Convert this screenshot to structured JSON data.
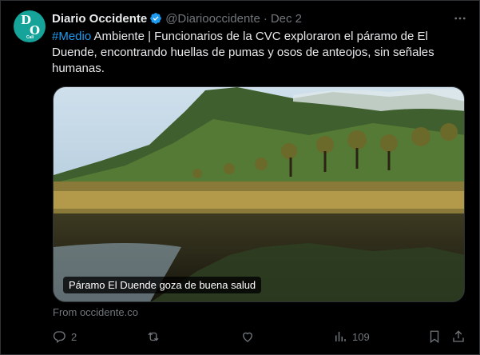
{
  "tweet": {
    "author_name": "Diario Occidente",
    "handle": "@Diariooccidente",
    "separator": "·",
    "date": "Dec 2",
    "avatar_letters": {
      "top": "D",
      "bottom": "O",
      "small": "Cali"
    },
    "hashtag": "#Medio",
    "text": " Ambiente | Funcionarios de la CVC exploraron el páramo de El Duende, encontrando huellas de pumas y osos de anteojos, sin señales humanas."
  },
  "card": {
    "caption": "Páramo El Duende goza de buena salud",
    "source": "From occidente.co"
  },
  "actions": {
    "replies": "2",
    "views": "109"
  },
  "colors": {
    "accent": "#1d9bf0",
    "muted": "#71767b",
    "avatar_bg": "#16a39a"
  },
  "icons": [
    "verified-badge-icon",
    "more-icon",
    "reply-icon",
    "retweet-icon",
    "like-icon",
    "views-icon",
    "bookmark-icon",
    "share-icon"
  ]
}
